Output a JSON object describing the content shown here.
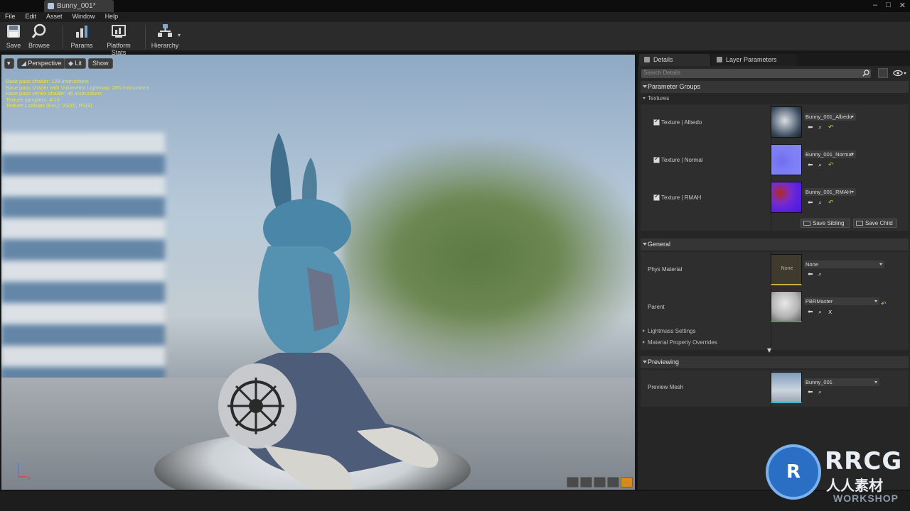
{
  "tab": {
    "title": "Bunny_001*"
  },
  "window_controls": {
    "minimize": "–",
    "maximize": "□",
    "close": "✕"
  },
  "menu": [
    "File",
    "Edit",
    "Asset",
    "Window",
    "Help"
  ],
  "toolbar": {
    "save": "Save",
    "browse": "Browse",
    "params": "Params",
    "platform_stats": "Platform Stats",
    "hierarchy": "Hierarchy"
  },
  "viewport": {
    "perspective": "Perspective",
    "lit": "Lit",
    "show": "Show",
    "stats": [
      "Base pass shader: 128 instructions",
      "Base pass shader with Volumetric Lightmap: 205 instructions",
      "Base pass vertex shader: 46 instructions",
      "Texture samplers: 4/16",
      "Texture Lookups (Est.): VS(0), PS(3)"
    ]
  },
  "details": {
    "tab_details": "Details",
    "tab_layer": "Layer Parameters",
    "search_placeholder": "Search Details",
    "parameter_groups": "Parameter Groups",
    "textures_group": "Textures",
    "textures": [
      {
        "label": "Texture | Albedo",
        "value": "Bunny_001_Albedo",
        "checked": true
      },
      {
        "label": "Texture | Normal",
        "value": "Bunny_001_Normal",
        "checked": true
      },
      {
        "label": "Texture | RMAH",
        "value": "Bunny_001_RMAH",
        "checked": true
      }
    ],
    "save_sibling": "Save Sibling",
    "save_child": "Save Child",
    "general": "General",
    "phys_material_label": "Phys Material",
    "phys_material_value": "None",
    "phys_thumb_text": "None",
    "parent_label": "Parent",
    "parent_value": "PBRMaster",
    "lightmass": "Lightmass Settings",
    "overrides": "Material Property Overrides",
    "previewing": "Previewing",
    "preview_mesh_label": "Preview Mesh",
    "preview_mesh_value": "Bunny_001"
  },
  "branding": {
    "logo_text": "RRCG",
    "logo_sub": "人人素材",
    "logo_ws": "WORKSHOP"
  },
  "colors": {
    "accent_orange": "#d28a23",
    "bg_panel": "#262626",
    "stats_yellow": "#e8e24a"
  }
}
